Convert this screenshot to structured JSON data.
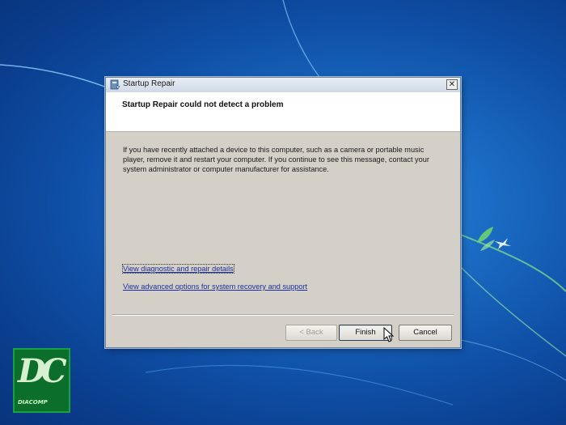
{
  "window": {
    "title": "Startup Repair",
    "close_glyph": "✕",
    "header_title": "Startup Repair could not detect a problem",
    "message": "If you have recently attached a device to this computer, such as a camera or portable music player, remove it and restart your computer. If you continue to see this message, contact your system administrator or computer manufacturer for assistance.",
    "links": {
      "diagnostic": "View diagnostic and repair details",
      "advanced": "View advanced options for system recovery and support"
    },
    "buttons": {
      "back": "< Back",
      "finish": "Finish",
      "cancel": "Cancel"
    }
  },
  "logo": {
    "letters": "DC",
    "caption": "DIACOMP"
  },
  "icons": {
    "title_icon": "startup-repair-icon",
    "cursor": "mouse-pointer-icon",
    "bird": "bird-icon"
  },
  "colors": {
    "desktop": "#1b6cc4",
    "dialog": "#d4d0c8",
    "link": "#1b2f9c",
    "logo_bg": "#0b6e2a"
  }
}
